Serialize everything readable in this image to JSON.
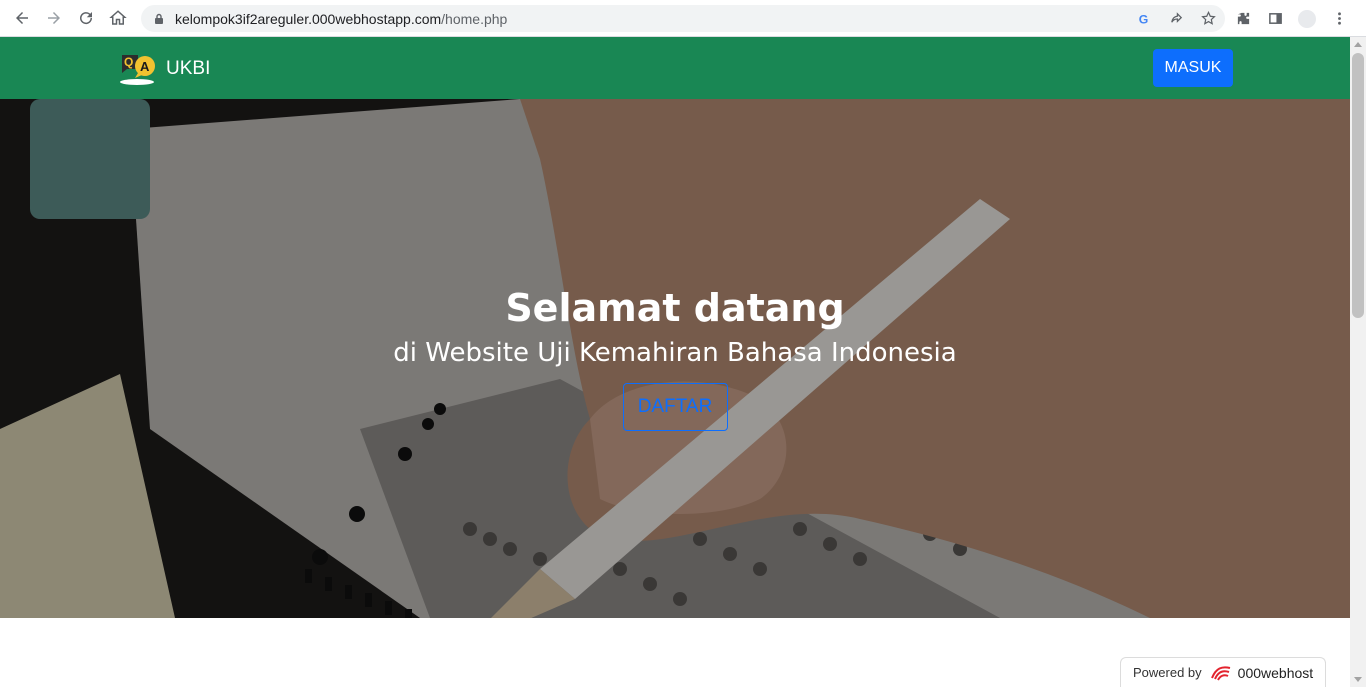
{
  "browser": {
    "url_host": "kelompok3if2areguler.000webhostapp.com",
    "url_path": "/home.php"
  },
  "navbar": {
    "brand": "UKBI",
    "logo_letters": [
      "Q",
      "A"
    ],
    "login_label": "MASUK"
  },
  "hero": {
    "title": "Selamat datang",
    "subtitle": "di Website Uji Kemahiran Bahasa Indonesia",
    "register_label": "DAFTAR"
  },
  "footer": {
    "powered_by": "Powered by",
    "host_brand": "000webhost"
  },
  "colors": {
    "navbar": "#198754",
    "primary": "#0d6efd"
  }
}
